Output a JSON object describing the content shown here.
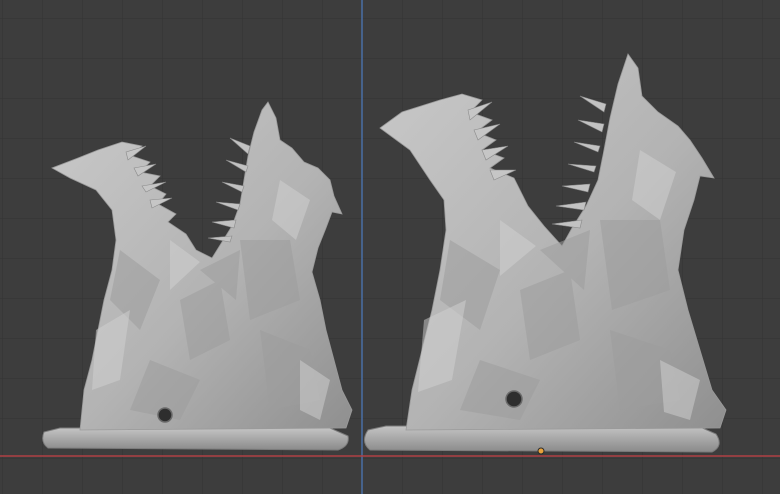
{
  "app": {
    "name": "3D Viewport"
  },
  "viewport": {
    "background": "#3d3d3d",
    "grid_color": "#333333",
    "x_axis_color": "#b04044",
    "z_axis_color": "#4a6fa5",
    "origin_color": "#e9a23b",
    "mesh_color": "#b8b8b8",
    "mesh_shadow_color": "#8e8e8e",
    "objects": [
      {
        "label": "mesh-left",
        "view": "front"
      },
      {
        "label": "mesh-right",
        "view": "front"
      }
    ]
  }
}
